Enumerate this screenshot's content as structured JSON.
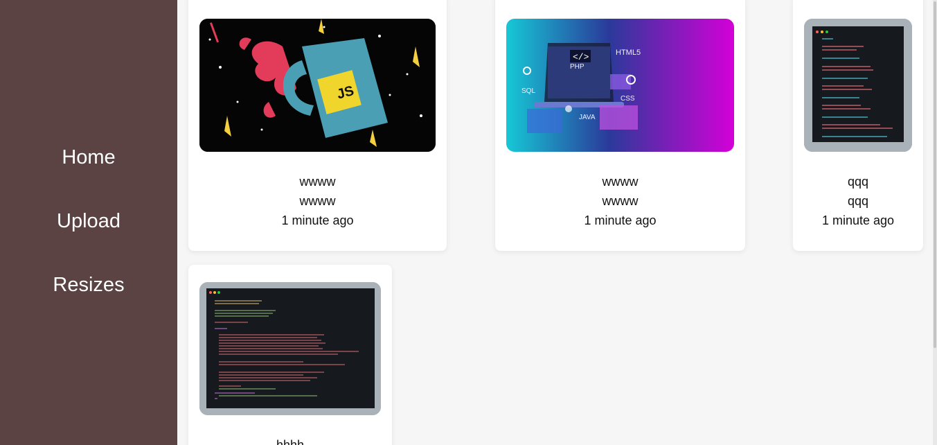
{
  "sidebar": {
    "items": [
      {
        "label": "Home"
      },
      {
        "label": "Upload"
      },
      {
        "label": "Resizes"
      }
    ]
  },
  "cards": [
    {
      "title": "wwww",
      "subtitle": "wwww",
      "time": "1 minute ago",
      "image": "javascript-mug-illustration"
    },
    {
      "title": "wwww",
      "subtitle": "wwww",
      "time": "1 minute ago",
      "image": "web-technologies-laptop-illustration"
    },
    {
      "title": "qqq",
      "subtitle": "qqq",
      "time": "1 minute ago",
      "image": "php-code-screenshot"
    },
    {
      "title": "hhhh",
      "image": "phpmailer-code-screenshot"
    }
  ],
  "colors": {
    "sidebar": "#5a4342",
    "card": "#ffffff",
    "background": "#f6f6f6"
  }
}
